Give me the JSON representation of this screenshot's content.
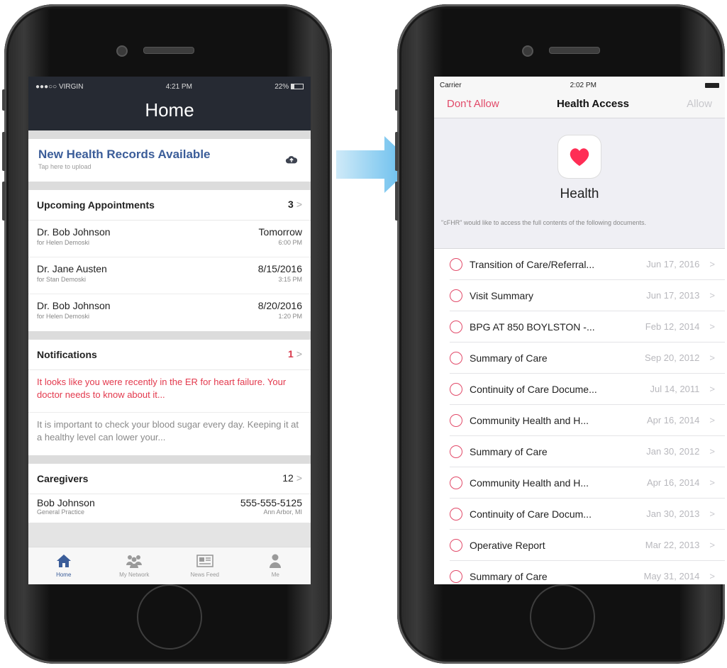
{
  "left": {
    "status": {
      "carrier": "●●●○○ VIRGIN",
      "time": "4:21 PM",
      "battery": "22%"
    },
    "title": "Home",
    "records": {
      "title": "New Health Records Available",
      "subtitle": "Tap here to upload",
      "icon": "cloud-upload-icon"
    },
    "appointments": {
      "header": "Upcoming Appointments",
      "count": "3",
      "items": [
        {
          "name": "Dr. Bob Johnson",
          "for": "for Helen Demoski",
          "date": "Tomorrow",
          "time": "6:00 PM"
        },
        {
          "name": "Dr. Jane Austen",
          "for": "for Stan Demoski",
          "date": "8/15/2016",
          "time": "3:15 PM"
        },
        {
          "name": "Dr. Bob Johnson",
          "for": "for Helen Demoski",
          "date": "8/20/2016",
          "time": "1:20 PM"
        }
      ]
    },
    "notifications": {
      "header": "Notifications",
      "count": "1",
      "items": [
        "It looks like you were recently in the ER for heart failure. Your doctor needs to know about it...",
        "It is important to check your blood sugar every day. Keeping it at a healthy level can lower your..."
      ]
    },
    "caregivers": {
      "header": "Caregivers",
      "count": "12",
      "items": [
        {
          "name": "Bob Johnson",
          "role": "General Practice",
          "phone": "555-555-5125",
          "location": "Ann Arbor, MI"
        }
      ]
    },
    "tabs": [
      {
        "label": "Home"
      },
      {
        "label": "My Network"
      },
      {
        "label": "News Feed"
      },
      {
        "label": "Me"
      }
    ],
    "colors": {
      "header": "#262a33",
      "accent": "#3b5d99",
      "alert": "#e3394d"
    }
  },
  "right": {
    "status": {
      "carrier": "Carrier",
      "time": "2:02 PM"
    },
    "nav": {
      "left": "Don't Allow",
      "title": "Health Access",
      "right": "Allow"
    },
    "app_name": "Health",
    "description": "\"cFHR\" would like to access the full contents of the following documents.",
    "documents": [
      {
        "title": "Transition of Care/Referral...",
        "date": "Jun 17, 2016"
      },
      {
        "title": "Visit Summary",
        "date": "Jun 17, 2013"
      },
      {
        "title": "BPG AT 850 BOYLSTON -...",
        "date": "Feb 12, 2014"
      },
      {
        "title": "Summary of Care",
        "date": "Sep 20, 2012"
      },
      {
        "title": "Continuity of Care Docume...",
        "date": "Jul 14, 2011"
      },
      {
        "title": "Community Health and H...",
        "date": "Apr 16, 2014"
      },
      {
        "title": "Summary of Care",
        "date": "Jan 30, 2012"
      },
      {
        "title": "Community Health and H...",
        "date": "Apr 16, 2014"
      },
      {
        "title": "Continuity of Care Docum...",
        "date": "Jan 30, 2013"
      },
      {
        "title": "Operative Report",
        "date": "Mar 22, 2013"
      },
      {
        "title": "Summary of Care",
        "date": "May 31, 2014"
      }
    ],
    "colors": {
      "accent": "#e24a69",
      "heart": "#ff2d55"
    }
  }
}
